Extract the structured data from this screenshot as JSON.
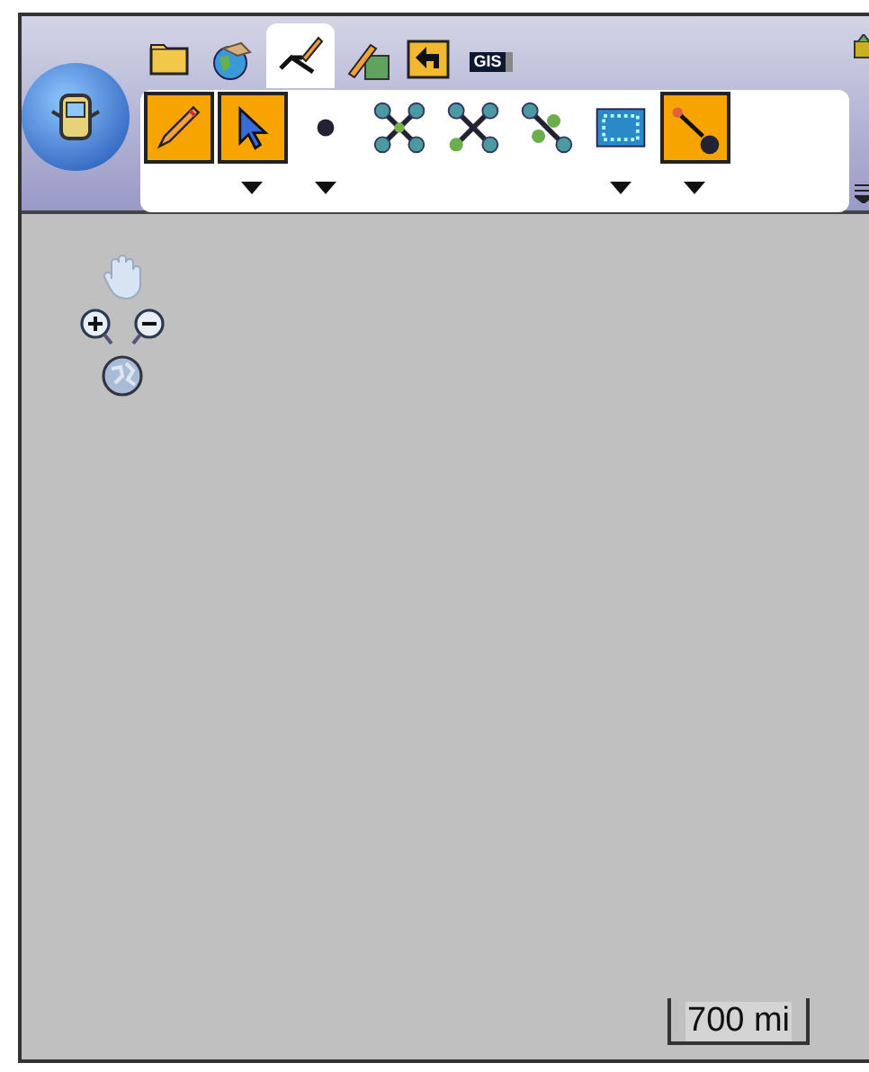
{
  "tabs": [
    {
      "kind": "folder",
      "selected": false
    },
    {
      "kind": "globe",
      "selected": false
    },
    {
      "kind": "draw",
      "selected": true
    },
    {
      "kind": "edit-map",
      "selected": false
    },
    {
      "kind": "back",
      "selected": false
    },
    {
      "kind": "gis",
      "label": "GIS",
      "selected": false
    }
  ],
  "tools": [
    {
      "kind": "pencil",
      "selected": true,
      "dropdown": false
    },
    {
      "kind": "pointer",
      "selected": true,
      "dropdown": true
    },
    {
      "kind": "point",
      "selected": false,
      "dropdown": true
    },
    {
      "kind": "network-a",
      "selected": false,
      "dropdown": false
    },
    {
      "kind": "network-b",
      "selected": false,
      "dropdown": false
    },
    {
      "kind": "network-c",
      "selected": false,
      "dropdown": false
    },
    {
      "kind": "grid",
      "selected": false,
      "dropdown": true
    },
    {
      "kind": "line-end",
      "selected": true,
      "dropdown": true
    }
  ],
  "scale_bar": {
    "label": "700 mi"
  }
}
